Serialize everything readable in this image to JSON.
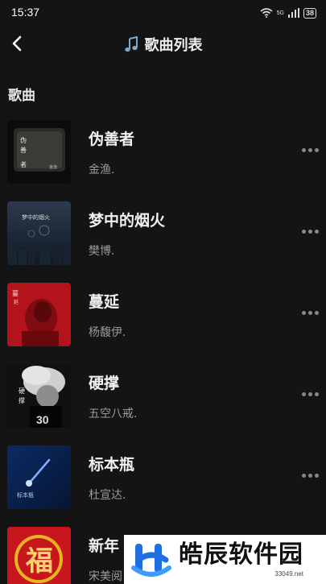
{
  "status": {
    "time": "15:37",
    "network": "5G",
    "battery": "38"
  },
  "nav": {
    "title": "歌曲列表"
  },
  "section": {
    "label": "歌曲"
  },
  "songs": [
    {
      "title": "伪善者",
      "artist": "金渔."
    },
    {
      "title": "梦中的烟火",
      "artist": "樊博."
    },
    {
      "title": "蔓延",
      "artist": "杨馥伊."
    },
    {
      "title": "硬撑",
      "artist": "五空八戒."
    },
    {
      "title": "标本瓶",
      "artist": "杜宣达."
    },
    {
      "title": "新年",
      "artist": "宋美阅"
    }
  ],
  "watermark": {
    "name": "皓辰软件园",
    "url": "33049.net"
  }
}
